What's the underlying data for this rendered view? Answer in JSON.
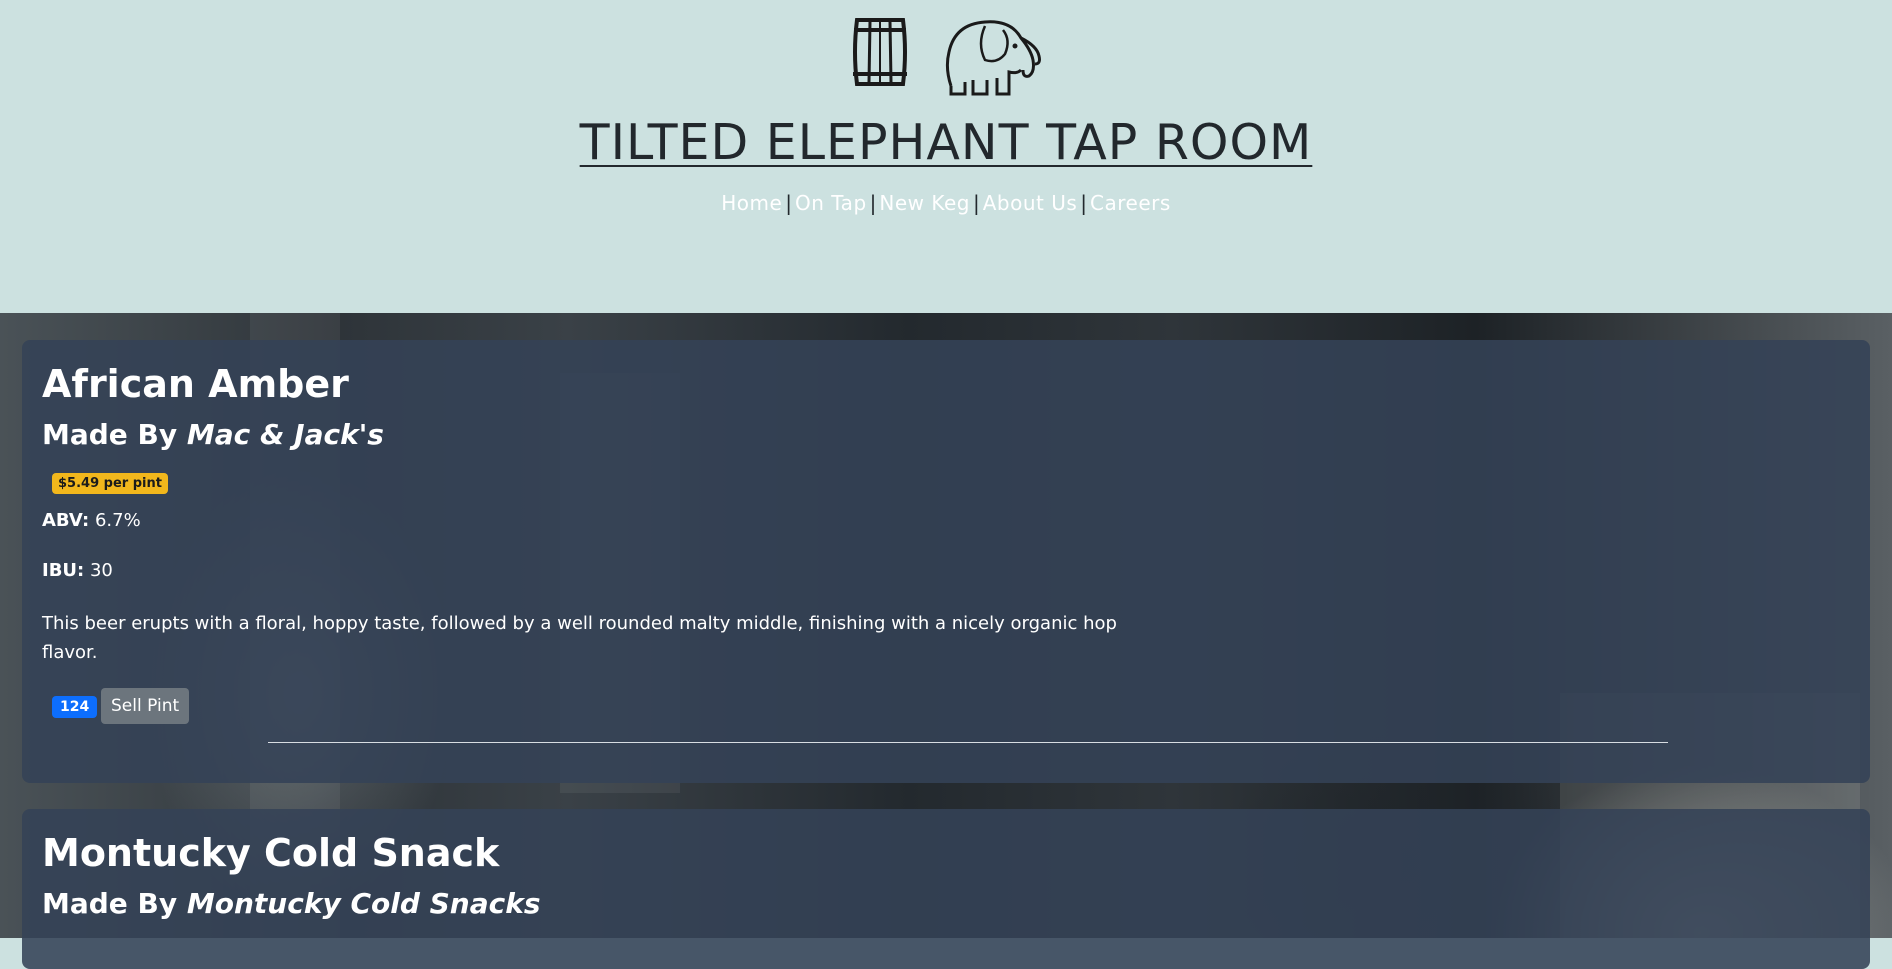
{
  "header": {
    "title": "TILTED ELEPHANT TAP ROOM",
    "logos": [
      "barrel-icon",
      "elephant-icon"
    ],
    "nav": [
      {
        "label": "Home"
      },
      {
        "label": "On Tap"
      },
      {
        "label": "New Keg"
      },
      {
        "label": "About Us"
      },
      {
        "label": "Careers"
      }
    ],
    "nav_separator": "|"
  },
  "beers": [
    {
      "name": "African Amber",
      "made_by_prefix": "Made By",
      "brewer": "Mac & Jack's",
      "price": "$5.49 per pint",
      "abv_label": "ABV:",
      "abv": "6.7%",
      "ibu_label": "IBU:",
      "ibu": "30",
      "description": "This beer erupts with a floral, hoppy taste, followed by a well rounded malty middle, finishing with a nicely organic hop flavor.",
      "pints_left": "124",
      "sell_label": "Sell Pint"
    },
    {
      "name": "Montucky Cold Snack",
      "made_by_prefix": "Made By",
      "brewer": "Montucky Cold Snacks"
    }
  ],
  "colors": {
    "header_bg": "#cce1e0",
    "card_bg": "#344256",
    "price_badge": "#f2b71c",
    "count_badge": "#0d6efd",
    "sell_button": "#6c757d"
  }
}
